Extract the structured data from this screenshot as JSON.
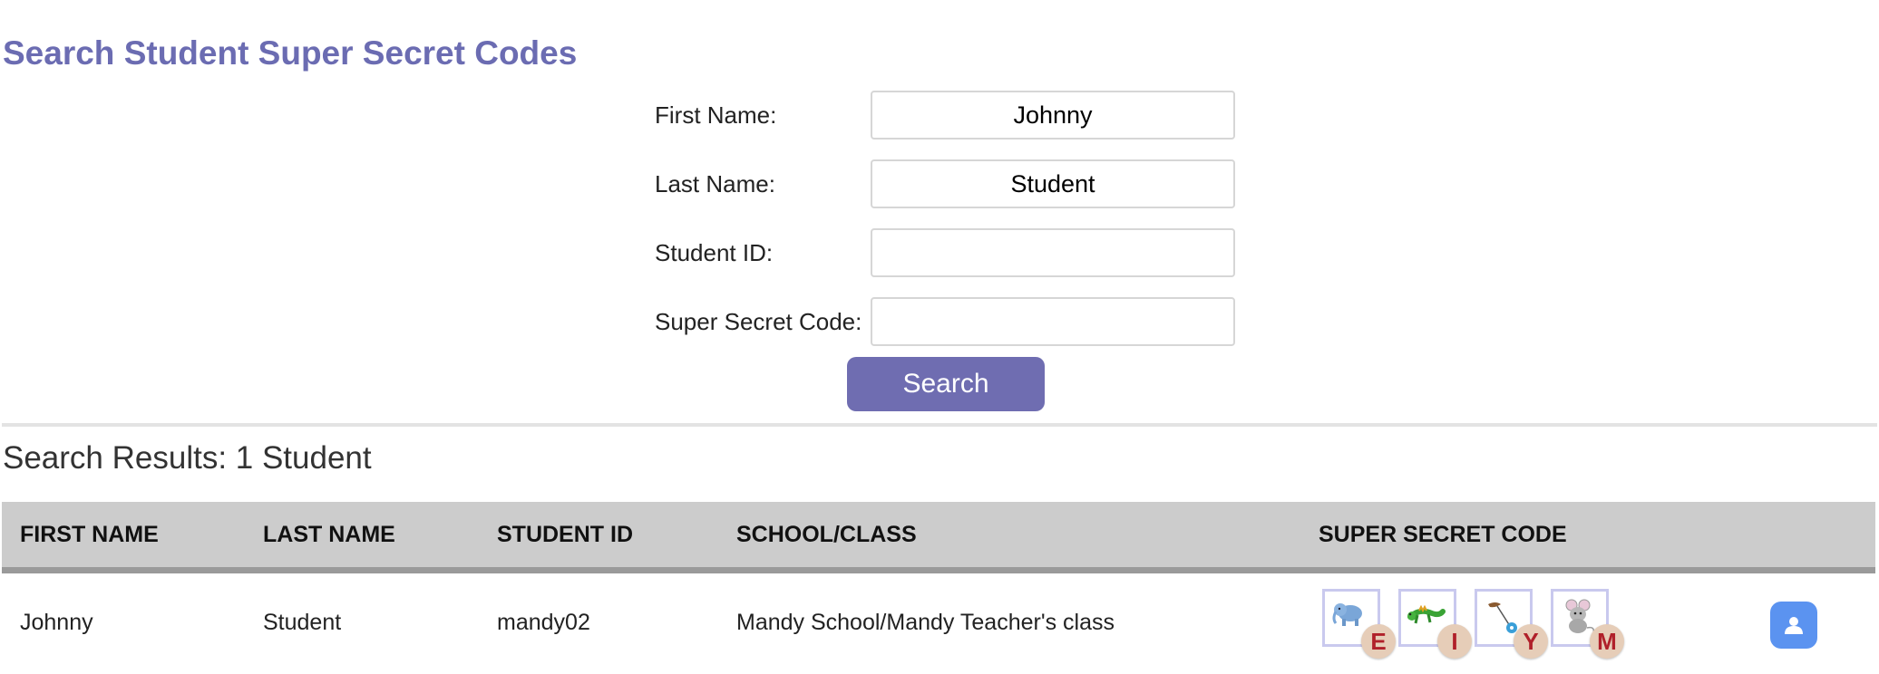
{
  "page": {
    "title": "Search Student Super Secret Codes"
  },
  "form": {
    "first_name": {
      "label": "First Name:",
      "value": "Johnny",
      "placeholder": ""
    },
    "last_name": {
      "label": "Last Name:",
      "value": "Student",
      "placeholder": ""
    },
    "student_id": {
      "label": "Student ID:",
      "value": "",
      "placeholder": ""
    },
    "secret_code": {
      "label": "Super Secret Code:",
      "value": "",
      "placeholder": ""
    },
    "search_label": "Search"
  },
  "results": {
    "heading": "Search Results: 1 Student",
    "columns": [
      "FIRST NAME",
      "LAST NAME",
      "STUDENT ID",
      "SCHOOL/CLASS",
      "SUPER SECRET CODE"
    ],
    "rows": [
      {
        "first_name": "Johnny",
        "last_name": "Student",
        "student_id": "mandy02",
        "school_class": "Mandy School/Mandy Teacher's class",
        "code": [
          {
            "icon": "elephant-icon",
            "letter": "E"
          },
          {
            "icon": "iguana-icon",
            "letter": "I"
          },
          {
            "icon": "yo-yo-icon",
            "letter": "Y"
          },
          {
            "icon": "mouse-icon",
            "letter": "M"
          }
        ]
      }
    ]
  },
  "colors": {
    "title": "#6b6cb2",
    "search_button": "#6f6db1",
    "header_bg": "#cccccc",
    "tile_border": "#c9c9ee",
    "badge_bg": "#e6cdb8",
    "badge_text": "#b0202a",
    "profile_button": "#5b93f0"
  }
}
